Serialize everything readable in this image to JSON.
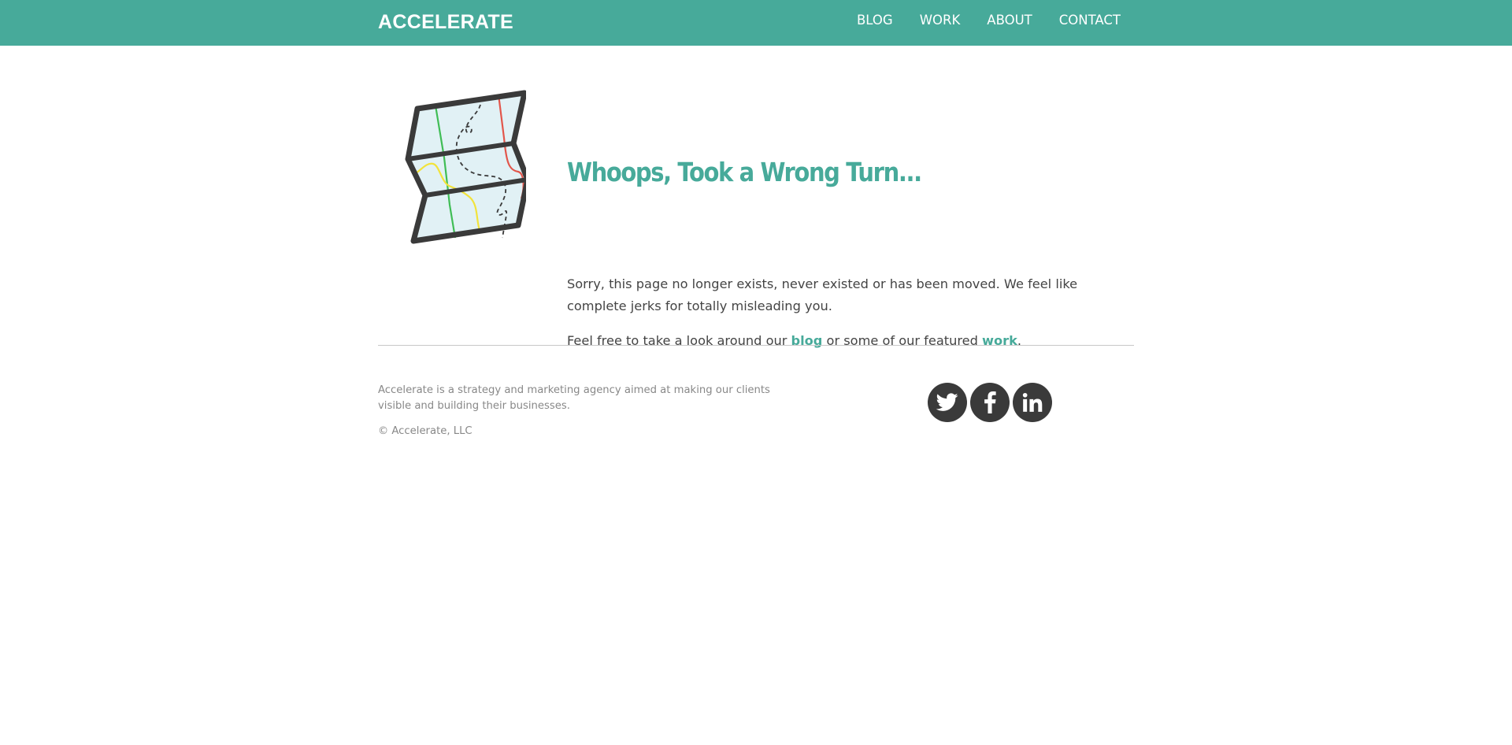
{
  "header": {
    "logo": "ACCELERATE",
    "nav": [
      {
        "label": "BLOG"
      },
      {
        "label": "WORK"
      },
      {
        "label": "ABOUT"
      },
      {
        "label": "CONTACT"
      }
    ]
  },
  "main": {
    "headline": "Whoops, Took a Wrong Turn...",
    "paragraph1": "Sorry, this page no longer exists, never existed or has been moved. We feel like complete jerks for totally misleading you.",
    "paragraph2_before": "Feel free to take a look around our ",
    "paragraph2_link1": "blog",
    "paragraph2_middle": " or some of our featured ",
    "paragraph2_link2": "work",
    "paragraph2_after": "."
  },
  "footer": {
    "about": "Accelerate is a strategy and marketing agency aimed at making our clients visible and building their businesses.",
    "copyright": "© Accelerate, LLC",
    "social": [
      {
        "icon": "twitter-icon"
      },
      {
        "icon": "facebook-icon"
      },
      {
        "icon": "linkedin-icon"
      }
    ]
  },
  "colors": {
    "brand": "#47aa9a",
    "dark": "#3a3a3a",
    "text": "#444444",
    "muted": "#888888"
  }
}
